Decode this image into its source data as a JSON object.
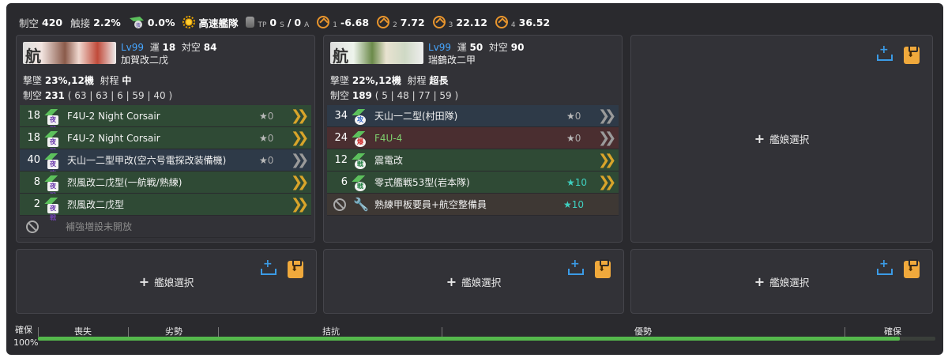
{
  "fleet_stats": {
    "air_power_label": "制空",
    "air_power": "420",
    "contact_label": "触接",
    "contact": "2.2%",
    "night_contact": "0.0%",
    "formation": "高速艦隊",
    "tp_main": "0",
    "tp_sub": "S",
    "slash": "/",
    "tp_a": "0",
    "tp_a_sub": "A",
    "range1_sub": "1",
    "range1": "-6.68",
    "range2_sub": "2",
    "range2": "7.72",
    "range3_sub": "3",
    "range3": "22.12",
    "range4_sub": "4",
    "range4": "36.52",
    "tp_label": "TP"
  },
  "ships": [
    {
      "portrait_kanji": "航",
      "level": "Lv99",
      "luck_label": "運",
      "luck": "18",
      "aa_label": "対空",
      "aa": "84",
      "name": "加賀改二戊",
      "shootdown_label": "撃墜",
      "shootdown": "23%,12機",
      "range_label": "射程",
      "range": "中",
      "air_label": "制空",
      "air": "231",
      "air_detail": "( 63 | 63 | 6 | 59 | 40 )",
      "slots": [
        {
          "count": "18",
          "badge": "夜戦",
          "name": "F4U-2 Night Corsair",
          "star": "0"
        },
        {
          "count": "18",
          "badge": "夜戦",
          "name": "F4U-2 Night Corsair",
          "star": "0"
        },
        {
          "count": "40",
          "badge": "夜攻",
          "name": "天山一二型甲改(空六号電探改装備機)",
          "star": "0"
        },
        {
          "count": "8",
          "badge": "夜戦",
          "name": "烈風改二戊型(一航戦/熟練)",
          "star": ""
        },
        {
          "count": "2",
          "badge": "夜戦",
          "name": "烈風改二戊型",
          "star": ""
        }
      ],
      "reinforce_label": "補強増設未開放"
    },
    {
      "portrait_kanji": "航",
      "level": "Lv99",
      "luck_label": "運",
      "luck": "50",
      "aa_label": "対空",
      "aa": "90",
      "name": "瑞鶴改二甲",
      "shootdown_label": "撃墜",
      "shootdown": "22%,12機",
      "range_label": "射程",
      "range": "超長",
      "air_label": "制空",
      "air": "189",
      "air_detail": "( 5 | 48 | 77 | 59 )",
      "slots": [
        {
          "count": "34",
          "badge": "攻",
          "name": "天山一二型(村田隊)",
          "star": "0"
        },
        {
          "count": "24",
          "badge": "爆",
          "name": "F4U-4",
          "star": "0"
        },
        {
          "count": "12",
          "badge": "戦",
          "name": "震電改",
          "star": ""
        },
        {
          "count": "6",
          "badge": "戦",
          "name": "零式艦戦53型(岩本隊)",
          "star": "10"
        }
      ],
      "reinforce_name": "熟練甲板要員+航空整備員",
      "reinforce_star": "10"
    }
  ],
  "empty_slot_label": "艦娘選択",
  "gauge": {
    "left_label": "確保",
    "percent": "100%",
    "fill_fraction": 1.0,
    "labels": [
      "喪失",
      "劣勢",
      "拮抗",
      "優勢",
      "確保"
    ]
  }
}
